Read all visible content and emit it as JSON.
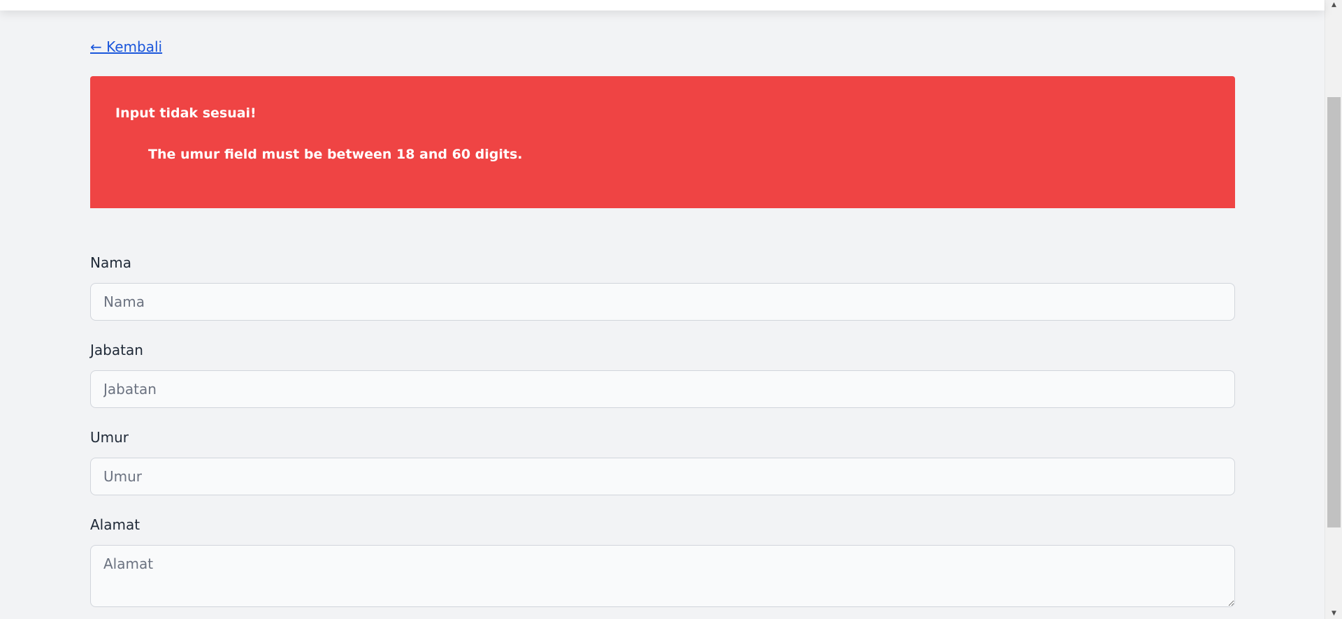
{
  "nav": {
    "back_label": "← Kembali"
  },
  "alert": {
    "title": "Input tidak sesuai!",
    "message": "The umur field must be between 18 and 60 digits.",
    "color": "#ef4444"
  },
  "form": {
    "nama": {
      "label": "Nama",
      "placeholder": "Nama",
      "value": ""
    },
    "jabatan": {
      "label": "Jabatan",
      "placeholder": "Jabatan",
      "value": ""
    },
    "umur": {
      "label": "Umur",
      "placeholder": "Umur",
      "value": ""
    },
    "alamat": {
      "label": "Alamat",
      "placeholder": "Alamat",
      "value": ""
    }
  },
  "scrollbar": {
    "up_icon": "scroll-up-arrow-icon",
    "down_icon": "scroll-down-arrow-icon"
  }
}
